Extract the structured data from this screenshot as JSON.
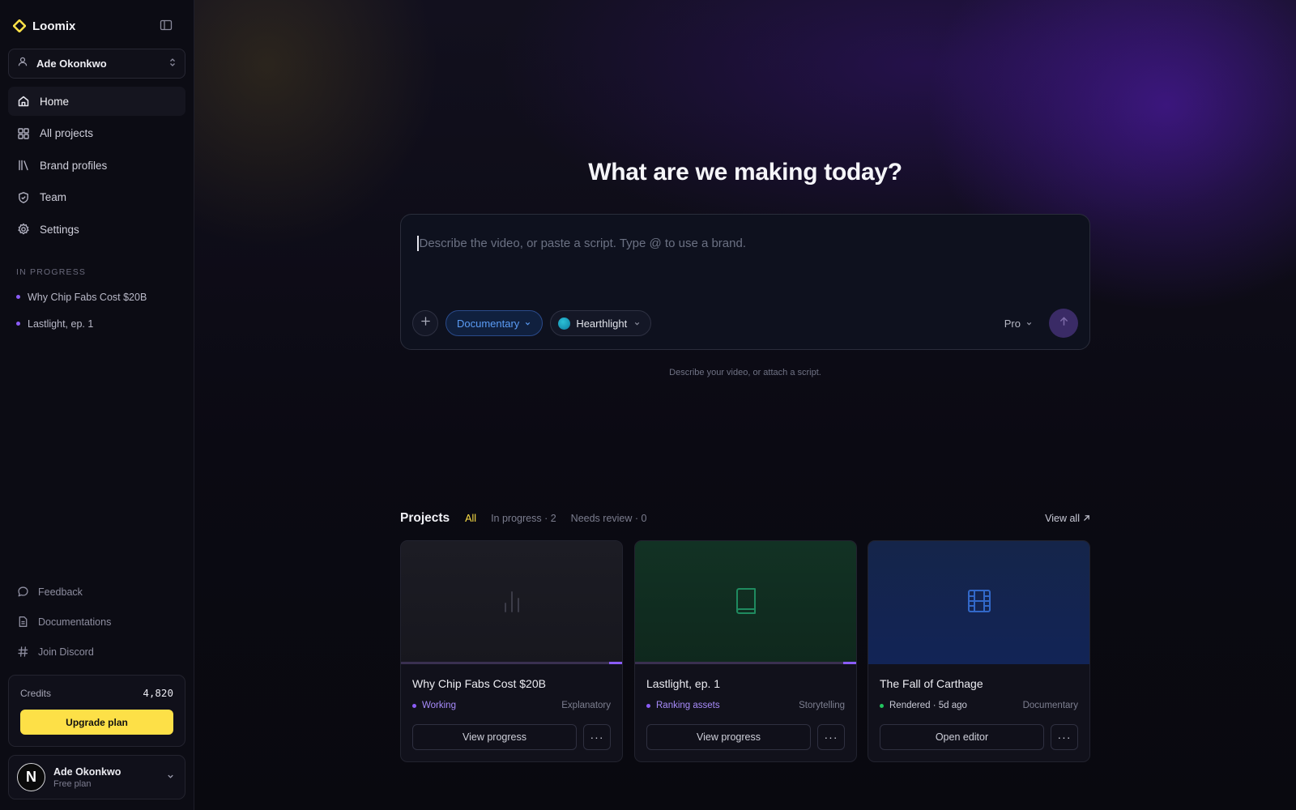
{
  "app": {
    "name": "Loomix",
    "brand_color": "#fde047"
  },
  "workspace": {
    "name": "Ade Okonkwo"
  },
  "nav": {
    "items": [
      {
        "label": "Home",
        "icon": "home-icon",
        "active": true
      },
      {
        "label": "All projects",
        "icon": "grid-icon",
        "active": false
      },
      {
        "label": "Brand profiles",
        "icon": "library-icon",
        "active": false
      },
      {
        "label": "Team",
        "icon": "shield-icon",
        "active": false
      },
      {
        "label": "Settings",
        "icon": "gear-icon",
        "active": false
      }
    ]
  },
  "in_progress": {
    "label": "IN PROGRESS",
    "items": [
      "Why Chip Fabs Cost $20B",
      "Lastlight, ep. 1"
    ]
  },
  "footer_links": [
    {
      "label": "Feedback",
      "icon": "chat-bubble-icon"
    },
    {
      "label": "Documentations",
      "icon": "document-icon"
    },
    {
      "label": "Join Discord",
      "icon": "hash-icon"
    }
  ],
  "credits": {
    "label": "Credits",
    "value": "4,820",
    "upgrade_label": "Upgrade plan"
  },
  "user": {
    "name": "Ade Okonkwo",
    "plan": "Free plan",
    "avatar_letter": "N"
  },
  "composer": {
    "headline": "What are we making today?",
    "placeholder": "Describe the video, or paste a script. Type @ to use a brand.",
    "style_chip": "Documentary",
    "brand_chip": "Hearthlight",
    "model": "Pro",
    "hint": "Describe your video, or attach a script."
  },
  "projects": {
    "title": "Projects",
    "tabs": [
      {
        "label": "All",
        "active": true
      },
      {
        "label": "In progress · 2",
        "active": false
      },
      {
        "label": "Needs review · 0",
        "active": false
      }
    ],
    "view_all": "View all",
    "cards": [
      {
        "title": "Why Chip Fabs Cost $20B",
        "status": "Working",
        "status_color": "#8b5cf6",
        "status_text_color": "#a78bfa",
        "genre": "Explanatory",
        "primary_action": "View progress",
        "more": "···",
        "thumb_icon": "bar-chart-icon",
        "progress": 0.06
      },
      {
        "title": "Lastlight, ep. 1",
        "status": "Ranking assets",
        "status_color": "#8b5cf6",
        "status_text_color": "#a78bfa",
        "genre": "Storytelling",
        "primary_action": "View progress",
        "more": "···",
        "thumb_icon": "book-icon",
        "progress": 0.06
      },
      {
        "title": "The Fall of Carthage",
        "status": "Rendered · 5d ago",
        "status_color": "#22c55e",
        "status_text_color": "#c9cad6",
        "genre": "Documentary",
        "primary_action": "Open editor",
        "more": "···",
        "thumb_icon": "film-icon",
        "progress": null
      }
    ]
  }
}
